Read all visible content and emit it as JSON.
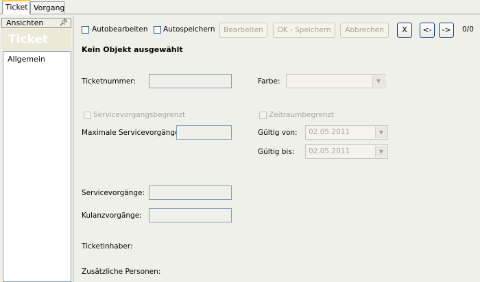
{
  "tabs": [
    {
      "label": "Ticket"
    },
    {
      "label": "Vorgang"
    }
  ],
  "sidebar": {
    "ansichten_label": "Ansichten",
    "pin_icon": "pin-icon",
    "header": "Ticket",
    "items": [
      {
        "label": "Allgemein"
      }
    ]
  },
  "toolbar": {
    "autobearbeiten_label": "Autobearbeiten",
    "autospeichern_label": "Autospeichern",
    "bearbeiten_label": "Bearbeiten",
    "ok_speichern_label": "OK - Speichern",
    "abbrechen_label": "Abbrechen",
    "close_label": "X",
    "prev_label": "<-",
    "next_label": "->",
    "counter": "0/0"
  },
  "status_text": "Kein Objekt ausgewählt",
  "form": {
    "ticketnummer_label": "Ticketnummer:",
    "farbe_label": "Farbe:",
    "servicevorgangsbegrenzt_label": "Servicevorgangsbegrenzt",
    "maximale_label": "Maximale Servicevorgänge:",
    "zeitraumbegrenzt_label": "Zeitraumbegrenzt",
    "gueltig_von_label": "Gültig von:",
    "gueltig_von_value": "02.05.2011",
    "gueltig_bis_label": "Gültig bis:",
    "gueltig_bis_value": "02.05.2011",
    "servicevorgaenge_label": "Servicevorgänge:",
    "kulanzvorgaenge_label": "Kulanzvorgänge:",
    "ticketinhaber_label": "Ticketinhaber:",
    "zusaetzliche_label": "Zusätzliche Personen:"
  },
  "colors": {
    "accent_tab": "#ffc83c",
    "frame": "#7f9db9",
    "background": "#f0f0ea"
  }
}
